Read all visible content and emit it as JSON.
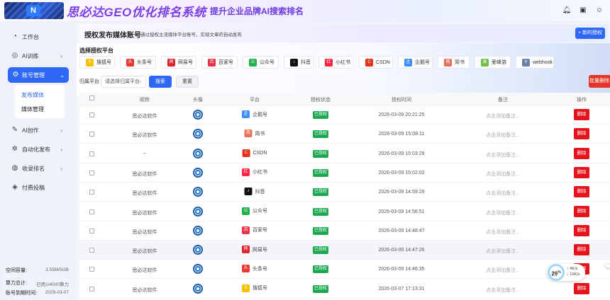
{
  "header": {
    "brand": "思必达GEO优化排名系统",
    "slogan": "提升企业品牌AI搜索排名",
    "icons": [
      "bell-icon",
      "clipboard-icon",
      "user-icon"
    ]
  },
  "sidebar": {
    "items": [
      {
        "label": "工作台",
        "icon": "gauge-icon"
      },
      {
        "label": "AI训练",
        "icon": "ai-icon"
      },
      {
        "label": "账号管理",
        "icon": "account-icon"
      },
      {
        "label": "AI创作",
        "icon": "pen-icon"
      },
      {
        "label": "自动化发布",
        "icon": "gear-icon"
      },
      {
        "label": "收录排名",
        "icon": "chart-icon"
      },
      {
        "label": "付费投稿",
        "icon": "money-icon"
      }
    ],
    "submenu": [
      "发布媒体",
      "媒体管理"
    ],
    "footer": {
      "space_label": "空间容量:",
      "space_value": "3.55M/5GB",
      "compute_label": "算力总计:",
      "compute_value": "已用1/4000算力",
      "expire_label": "账号到期时间:",
      "expire_value": "2029-03-07"
    }
  },
  "banner": {
    "title": "授权发布媒体账号",
    "desc": "通过授权主流媒体平台账号，实现文章的自动发布",
    "new_button": "+ 新的授权"
  },
  "platforms": {
    "title": "选择授权平台",
    "items": [
      {
        "label": "搜狐号",
        "color": "#f6c300",
        "glyph": "S"
      },
      {
        "label": "头条号",
        "color": "#e8382f",
        "glyph": "头"
      },
      {
        "label": "网易号",
        "color": "#e0232e",
        "glyph": "网"
      },
      {
        "label": "百家号",
        "color": "#e8344a",
        "glyph": "百"
      },
      {
        "label": "公众号",
        "color": "#23b14d",
        "glyph": "公"
      },
      {
        "label": "抖音",
        "color": "#111111",
        "glyph": "♪"
      },
      {
        "label": "小红书",
        "color": "#ff2442",
        "glyph": "红"
      },
      {
        "label": "CSDN",
        "color": "#e3331d",
        "glyph": "C"
      },
      {
        "label": "企鹅号",
        "color": "#3b8ff7",
        "glyph": "企"
      },
      {
        "label": "简书",
        "color": "#ea6f5a",
        "glyph": "简"
      },
      {
        "label": "爱峰游",
        "color": "#6fbf4a",
        "glyph": "爱"
      },
      {
        "label": "webhook",
        "color": "#6b7fa8",
        "glyph": "⚲"
      }
    ]
  },
  "filter": {
    "label": "归属平台",
    "placeholder": "请选择归属平台",
    "search": "搜索",
    "reset": "重置",
    "bulk_delete": "批量删除"
  },
  "table": {
    "columns": [
      "昵称",
      "头像",
      "平台",
      "授权状态",
      "授权时间",
      "备注",
      "操作"
    ],
    "rows": [
      {
        "nickname": "思必达软件",
        "platform": "企鹅号",
        "status": "已授权",
        "time": "2026-03-09 20:21:25",
        "note": "点击添加备注...",
        "action": "删除"
      },
      {
        "nickname": "思必达软件",
        "platform": "简书",
        "status": "已授权",
        "time": "2026-03-09 15:08:11",
        "note": "点击添加备注...",
        "action": "删除"
      },
      {
        "nickname": "--",
        "platform": "CSDN",
        "status": "已授权",
        "time": "2026-03-09 15:03:29",
        "note": "点击添加备注...",
        "action": "删除"
      },
      {
        "nickname": "思必达软件",
        "platform": "小红书",
        "status": "已授权",
        "time": "2026-03-09 15:02:02",
        "note": "点击添加备注...",
        "action": "删除"
      },
      {
        "nickname": "思必达软件",
        "platform": "抖音",
        "status": "已授权",
        "time": "2026-03-09 14:59:29",
        "note": "点击添加备注...",
        "action": "删除"
      },
      {
        "nickname": "思必达软件",
        "platform": "公众号",
        "status": "已授权",
        "time": "2026-03-09 14:56:51",
        "note": "点击添加备注...",
        "action": "删除"
      },
      {
        "nickname": "思必达软件",
        "platform": "百家号",
        "status": "已授权",
        "time": "2026-03-09 14:48:47",
        "note": "点击添加备注...",
        "action": "删除"
      },
      {
        "nickname": "思必达软件",
        "platform": "网易号",
        "status": "已授权",
        "time": "2026-03-09 14:47:26",
        "note": "点击添加备注...",
        "action": "删除"
      },
      {
        "nickname": "思必达软件",
        "platform": "头条号",
        "status": "已授权",
        "time": "2026-03-09 14:46:35",
        "note": "点击添加备注...",
        "action": "删除"
      },
      {
        "nickname": "思必达软件",
        "platform": "搜狐号",
        "status": "已授权",
        "time": "2026-03-07 17:13:31",
        "note": "点击添加备注...",
        "action": "删除"
      }
    ]
  },
  "speed_widget": {
    "percent": "29",
    "percent_sign": "%",
    "upload": "↑ 4K/s",
    "download": "↓ 10K/s"
  }
}
